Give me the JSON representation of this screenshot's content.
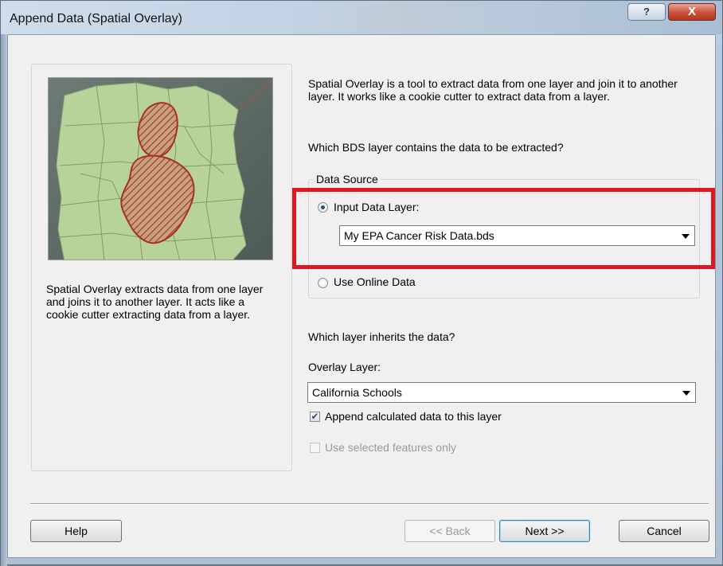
{
  "window": {
    "title": "Append Data (Spatial Overlay)",
    "help_glyph": "?",
    "close_glyph": "X"
  },
  "left_panel": {
    "description": "Spatial Overlay extracts data from one layer and joins it to another layer. It acts like a cookie cutter extracting data from a layer."
  },
  "intro_text": "Spatial Overlay is a tool to extract data from one layer and join it to another layer. It works like a cookie cutter to extract data from a layer.",
  "question1": "Which BDS layer contains the data to be extracted?",
  "data_source": {
    "legend": "Data Source",
    "input_layer_label": "Input Data Layer:",
    "input_layer_value": "My EPA Cancer Risk Data.bds",
    "online_label": "Use Online Data",
    "selected": "input"
  },
  "question2": "Which layer inherits the data?",
  "overlay": {
    "label": "Overlay Layer:",
    "value": "California Schools"
  },
  "append_checkbox": {
    "label": "Append calculated data to this layer",
    "checked": true
  },
  "selected_checkbox": {
    "label": "Use selected features only",
    "checked": false,
    "enabled": false
  },
  "buttons": {
    "help": "Help",
    "back": "<< Back",
    "next": "Next >>",
    "cancel": "Cancel"
  },
  "colors": {
    "highlight_box": "#e01622",
    "map_land": "#b8d39a",
    "overlay_region": "#b5292a"
  }
}
